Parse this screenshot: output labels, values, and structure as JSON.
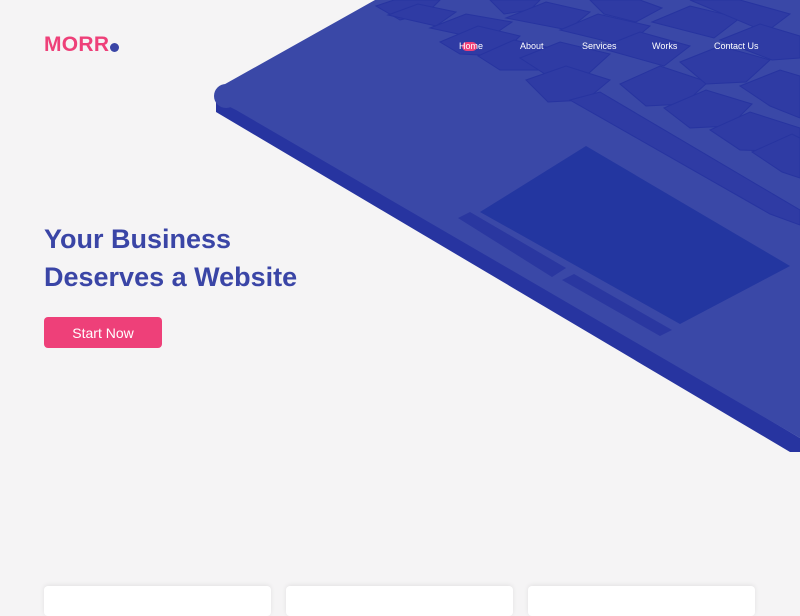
{
  "brand": {
    "name": "MORR"
  },
  "nav": {
    "items": [
      {
        "label": "Home",
        "active": true
      },
      {
        "label": "About",
        "active": false
      },
      {
        "label": "Services",
        "active": false
      },
      {
        "label": "Works",
        "active": false
      },
      {
        "label": "Contact Us",
        "active": false
      }
    ]
  },
  "hero": {
    "title_line1": "Your Business",
    "title_line2": "Deserves a Website",
    "cta_label": "Start Now"
  },
  "colors": {
    "accent_pink": "#ee4079",
    "brand_blue": "#3a45a6",
    "laptop_body": "#3a48a7",
    "laptop_edge": "#2734a0",
    "background": "#f5f4f5"
  },
  "illustration": {
    "name": "laptop-keyboard-illustration"
  }
}
